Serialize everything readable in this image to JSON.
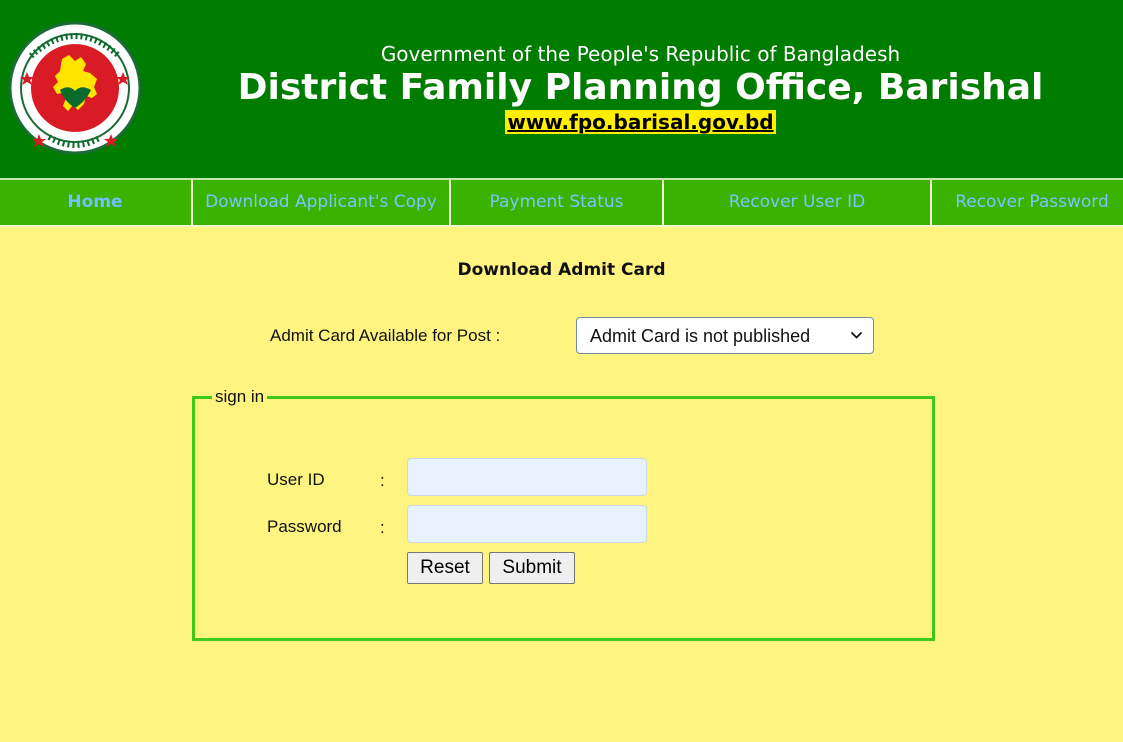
{
  "header": {
    "emblem_text": "গণপ্রজাতন্ত্রী বাংলাদেশ সরকার",
    "gov_line": "Government of the People's Republic of Bangladesh",
    "office_name": "District Family Planning Office, Barishal",
    "website": "www.fpo.barisal.gov.bd"
  },
  "nav": {
    "items": [
      {
        "label": "Home",
        "active": true
      },
      {
        "label": "Download Applicant's Copy",
        "active": false
      },
      {
        "label": "Payment Status",
        "active": false
      },
      {
        "label": "Recover User ID",
        "active": false
      },
      {
        "label": "Recover Password",
        "active": false
      }
    ]
  },
  "main": {
    "title": "Download Admit Card",
    "post_label": "Admit Card Available for Post :",
    "post_select_value": "Admit Card is not published",
    "signin": {
      "legend": "sign in",
      "user_id_label": "User ID",
      "password_label": "Password",
      "colon": ":",
      "user_id_value": "",
      "password_value": "",
      "reset_label": "Reset",
      "submit_label": "Submit"
    }
  },
  "colors": {
    "header_bg": "#007c00",
    "nav_bg": "#39b200",
    "nav_text": "#7cc3ff",
    "page_bg": "#fff480",
    "fieldset_border": "#40c81b",
    "url_highlight": "#ffee00",
    "emblem_red": "#d91b26",
    "emblem_green": "#0a6b2c",
    "emblem_yellow": "#ffe400"
  }
}
